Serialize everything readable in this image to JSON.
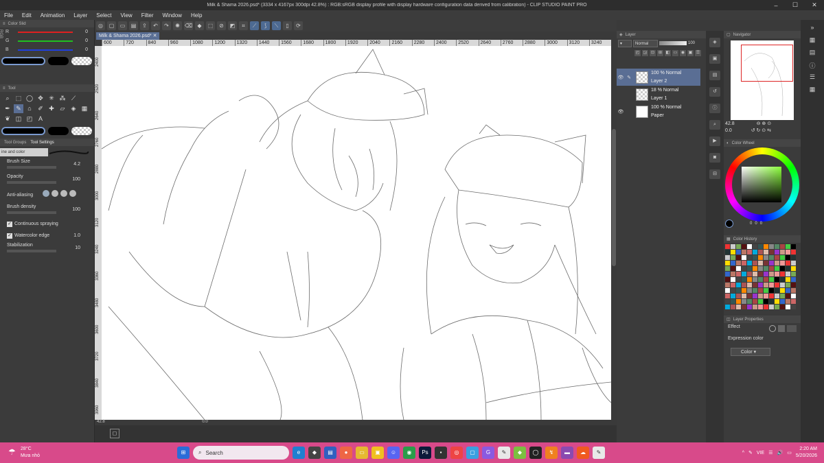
{
  "titlebar": {
    "title": "Milk & Shama 2026.psd* (3334 x 4167px 300dpi 42.8%) : RGB:sRGB display profile with display hardware configuration data derived from calibration) - CLIP STUDIO PAINT PRO",
    "minimize": "–",
    "maximize": "☐",
    "close": "✕"
  },
  "menu": [
    "File",
    "Edit",
    "Animation",
    "Layer",
    "Select",
    "View",
    "Filter",
    "Window",
    "Help"
  ],
  "document_tab": "Milk & Shama 2026.psd*",
  "ruler_ticks": [
    "600",
    "720",
    "840",
    "960",
    "1080",
    "1200",
    "1320",
    "1440",
    "1560",
    "1680",
    "1800",
    "1920",
    "2040",
    "2160",
    "2280",
    "2400",
    "2520",
    "2640",
    "2760",
    "2880",
    "3000",
    "3120",
    "3240"
  ],
  "ruler_vticks": [
    "2400",
    "2520",
    "2640",
    "2760",
    "2880",
    "3000",
    "3120",
    "3240",
    "3360",
    "3480",
    "3600",
    "3720",
    "3840",
    "3960"
  ],
  "color_slider": {
    "panel_label": "Color Slid",
    "mode": "RGB",
    "rows": [
      {
        "label": "R",
        "value": "0",
        "color": "#e02020"
      },
      {
        "label": "G",
        "value": "0",
        "color": "#20c020"
      },
      {
        "label": "B",
        "value": "0",
        "color": "#2040e0"
      }
    ]
  },
  "tool_panel": {
    "label": "Tool"
  },
  "tool_property": {
    "tabs": [
      "Tool Groups",
      "Tool Settings"
    ],
    "brush_name": "ine and color",
    "brush_size": {
      "label": "Brush Size",
      "value": "4.2"
    },
    "opacity": {
      "label": "Opacity",
      "value": "100"
    },
    "anti_aliasing": {
      "label": "Anti-aliasing"
    },
    "brush_density": {
      "label": "Brush density",
      "value": "100"
    },
    "continuous_spraying": {
      "label": "Continuous spraying",
      "checked": true
    },
    "watercolor_edge": {
      "label": "Watercolor edge",
      "value": "1.0",
      "checked": true
    },
    "stabilization": {
      "label": "Stabilization",
      "value": "10"
    }
  },
  "statusbar": {
    "zoom": "42.8",
    "rotation": "0.0"
  },
  "layer_panel": {
    "title": "Layer",
    "blend_mode": "Normal",
    "opacity": "100",
    "layers": [
      {
        "percent_blend": "100 % Normal",
        "name": "Layer 2",
        "selected": true
      },
      {
        "percent_blend": "18 % Normal",
        "name": "Layer 1",
        "selected": false
      },
      {
        "percent_blend": "100 % Normal",
        "name": "Paper",
        "selected": false
      }
    ]
  },
  "navigator": {
    "title": "Navigator",
    "zoom": "42.8",
    "rotation": "0.0"
  },
  "color_wheel": {
    "title": "Color Wheel",
    "values": [
      "0",
      "0",
      "0"
    ]
  },
  "color_history": {
    "title": "Color History"
  },
  "layer_properties": {
    "title": "Layer Properties",
    "effect_label": "Effect",
    "expression_label": "Expression color",
    "expression_value": "Color"
  },
  "taskbar": {
    "temperature": "28°C",
    "weather": "Mưa nhỏ",
    "search_placeholder": "Search",
    "language": "VIE",
    "time": "2:20 AM",
    "date": "5/20/2026"
  },
  "colors": {
    "accent": "#5a6e94",
    "taskbar": "#d84a8a",
    "panel": "#3b3b3b"
  }
}
